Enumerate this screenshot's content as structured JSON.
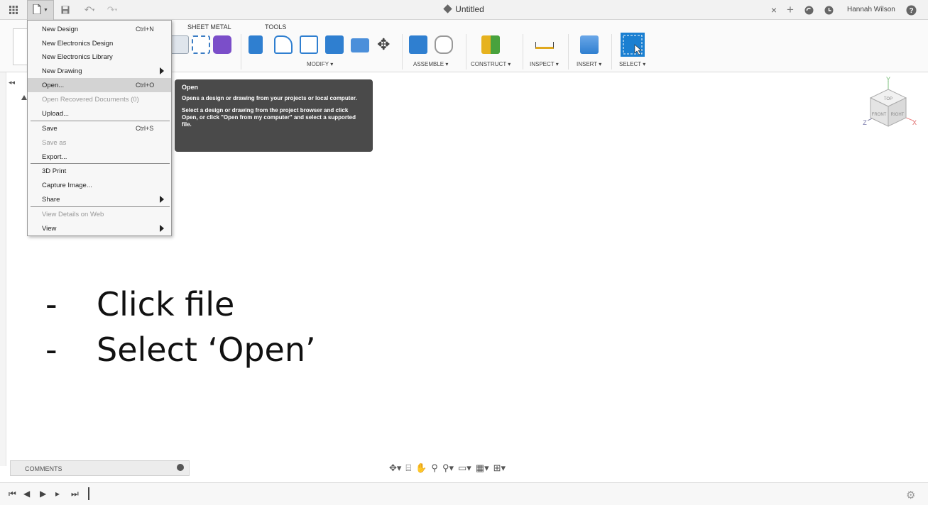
{
  "window": {
    "title": "Untitled",
    "user": "Hannah Wilson"
  },
  "toolbar": {
    "tabs": [
      "SHEET METAL",
      "TOOLS"
    ],
    "groups": [
      "MODIFY ▾",
      "ASSEMBLE ▾",
      "CONSTRUCT ▾",
      "INSPECT ▾",
      "INSERT ▾",
      "SELECT ▾"
    ]
  },
  "file_menu": {
    "items": [
      {
        "label": "New Design",
        "shortcut": "Ctrl+N"
      },
      {
        "label": "New Electronics Design",
        "shortcut": ""
      },
      {
        "label": "New Electronics Library",
        "shortcut": ""
      },
      {
        "label": "New Drawing",
        "shortcut": ""
      },
      {
        "label": "Open...",
        "shortcut": "Ctrl+O"
      },
      {
        "label": "Open Recovered Documents (0)",
        "shortcut": ""
      },
      {
        "label": "Upload...",
        "shortcut": ""
      },
      {
        "label": "Save",
        "shortcut": "Ctrl+S"
      },
      {
        "label": "Save as",
        "shortcut": ""
      },
      {
        "label": "Export...",
        "shortcut": ""
      },
      {
        "label": "3D Print",
        "shortcut": ""
      },
      {
        "label": "Capture Image...",
        "shortcut": ""
      },
      {
        "label": "Share",
        "shortcut": ""
      },
      {
        "label": "View Details on Web",
        "shortcut": ""
      },
      {
        "label": "View",
        "shortcut": ""
      }
    ]
  },
  "tooltip": {
    "title": "Open",
    "line1": "Opens a design or drawing from your projects or local computer.",
    "line2": "Select a design or drawing from the project browser and click Open, or click \"Open from my computer\" and select a supported file."
  },
  "viewcube": {
    "top": "TOP",
    "front": "FRONT",
    "right": "RIGHT",
    "axis_x": "X",
    "axis_y": "Y",
    "axis_z": "Z"
  },
  "instructions": {
    "dash": "-",
    "step1": "Click file",
    "step2": "Select ‘Open’"
  },
  "bottom": {
    "comments_label": "COMMENTS"
  },
  "icons": {
    "apps": "grid-icon",
    "file": "file-icon",
    "save": "save-icon",
    "undo": "undo-icon",
    "redo": "redo-icon",
    "close": "close-icon",
    "add": "plus-icon",
    "sync": "sync-icon",
    "clock": "clock-icon",
    "help": "help-icon",
    "settings": "gear-icon"
  },
  "colors": {
    "accent_blue": "#1a7fd1",
    "tooltip_bg": "#4a4a4a",
    "menu_hover": "#d3d3d3"
  }
}
